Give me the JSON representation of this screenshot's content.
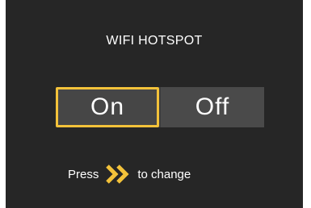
{
  "screen": {
    "title": "WIFI HOTSPOT",
    "toggle": {
      "on_label": "On",
      "off_label": "Off",
      "selected": "On"
    },
    "hint": {
      "prefix": "Press",
      "icon": "double-chevron-right-icon",
      "suffix": "to change"
    }
  },
  "colors": {
    "background": "#262626",
    "accent": "#f3c23a",
    "text": "#ffffff",
    "toggle_bg": "#3d3d3d"
  }
}
